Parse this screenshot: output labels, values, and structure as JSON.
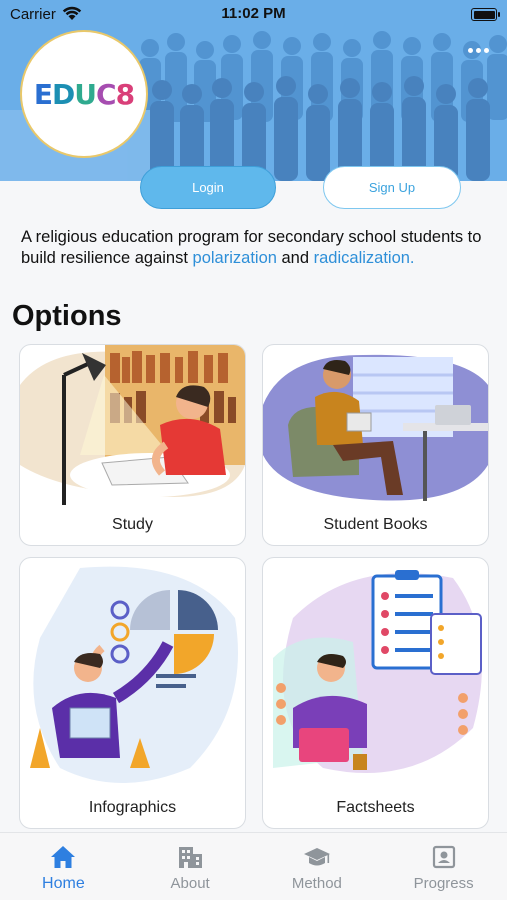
{
  "status_bar": {
    "carrier": "Carrier",
    "time": "11:02 PM"
  },
  "header": {
    "logo_text": {
      "e": "E",
      "d": "D",
      "u": "U",
      "c": "C",
      "n": "8"
    },
    "more_icon": "ellipsis-icon"
  },
  "auth": {
    "login_label": "Login",
    "signup_label": "Sign Up"
  },
  "description": {
    "part1": "A religious education program for secondary school students to build resilience against ",
    "link1": "polarization",
    "part2": " and ",
    "link2": "radicalization."
  },
  "options": {
    "title": "Options",
    "items": [
      {
        "label": "Study"
      },
      {
        "label": "Student Books"
      },
      {
        "label": "Infographics"
      },
      {
        "label": "Factsheets"
      }
    ]
  },
  "tabs": [
    {
      "label": "Home",
      "icon": "home-icon",
      "active": true
    },
    {
      "label": "About",
      "icon": "building-icon",
      "active": false
    },
    {
      "label": "Method",
      "icon": "graduation-cap-icon",
      "active": false
    },
    {
      "label": "Progress",
      "icon": "id-card-icon",
      "active": false
    }
  ],
  "colors": {
    "accent": "#2e7fe0",
    "header_bg": "#6aaee8",
    "login_bg": "#5fb8ec",
    "link": "#2e8fd8"
  }
}
